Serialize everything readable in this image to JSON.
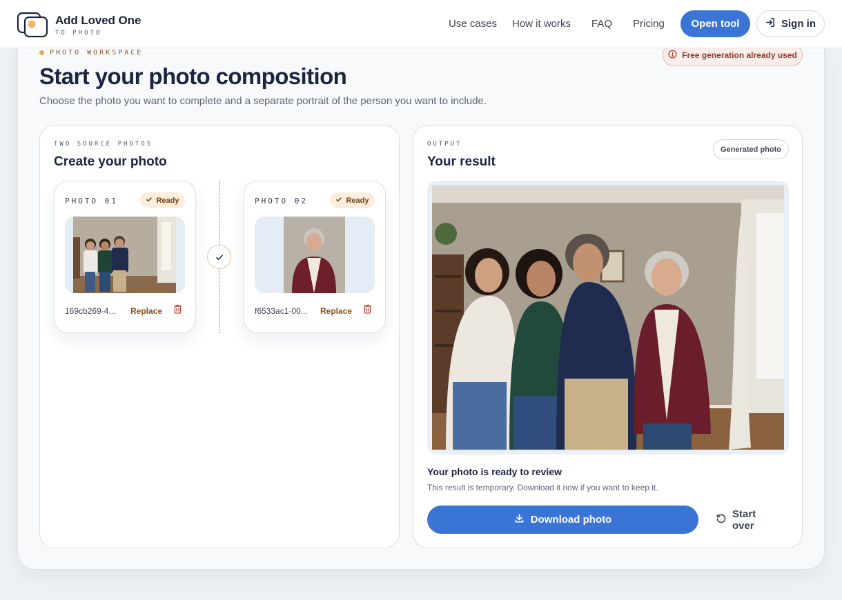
{
  "brand": {
    "name": "Add Loved One",
    "sub": "TO PHOTO"
  },
  "nav": {
    "links": [
      "Use cases",
      "How it works",
      "FAQ",
      "Pricing"
    ],
    "open_tool": "Open tool",
    "sign_in": "Sign in"
  },
  "workspace": {
    "eyebrow": "PHOTO WORKSPACE",
    "free_badge": "Free generation already used",
    "title": "Start your photo composition",
    "subtitle": "Choose the photo you want to complete and a separate portrait of the person you want to include."
  },
  "sources": {
    "eyebrow": "TWO SOURCE PHOTOS",
    "title": "Create your photo",
    "slots": [
      {
        "label": "PHOTO 01",
        "status": "Ready",
        "file": "169cb269-4...",
        "replace": "Replace"
      },
      {
        "label": "PHOTO 02",
        "status": "Ready",
        "file": "f6533ac1-00...",
        "replace": "Replace"
      }
    ]
  },
  "output": {
    "eyebrow": "OUTPUT",
    "title": "Your result",
    "badge": "Generated photo",
    "ready_title": "Your photo is ready to review",
    "ready_sub": "This result is temporary. Download it now if you want to keep it.",
    "download": "Download photo",
    "start_over": "Start over"
  },
  "colors": {
    "accent": "#3a74d4",
    "warm": "#e7a65c",
    "alert": "#8a3b2a"
  }
}
